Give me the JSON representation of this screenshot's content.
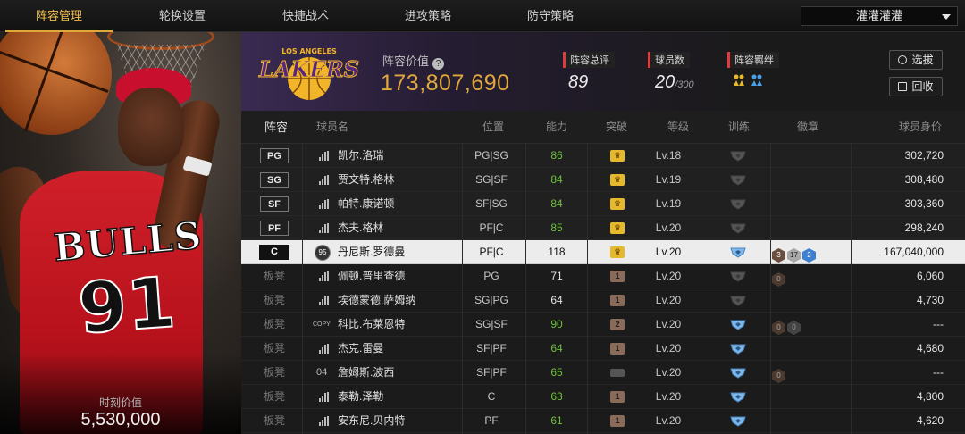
{
  "nav": {
    "tabs": [
      {
        "label": "阵容管理",
        "active": true
      },
      {
        "label": "轮换设置",
        "active": false
      },
      {
        "label": "快捷战术",
        "active": false
      },
      {
        "label": "进攻策略",
        "active": false
      },
      {
        "label": "防守策略",
        "active": false
      }
    ],
    "team_selector": "灌灌灌灌"
  },
  "player_card": {
    "jersey_name": "BULLS",
    "jersey_number": "91",
    "value_label": "时刻价值",
    "value": "5,530,000"
  },
  "header": {
    "logo_text": "LAKERS",
    "logo_city": "LOS ANGELES",
    "lineup_value_label": "阵容价值",
    "lineup_value": "173,807,690",
    "rating_label": "阵容总评",
    "rating_value": "89",
    "players_label": "球员数",
    "players_value": "20",
    "players_max": "/300",
    "bonds_label": "阵容羁绊",
    "select_button": "选拔",
    "recycle_button": "回收"
  },
  "table": {
    "columns": [
      "阵容",
      "球员名",
      "位置",
      "能力",
      "突破",
      "等级",
      "训练",
      "徽章",
      "球员身价"
    ],
    "rows": [
      {
        "slot": "PG",
        "type": "starter",
        "icon": "bars",
        "name": "凯尔.洛瑞",
        "pos": "PG|SG",
        "ovr": "86",
        "ovr_color": "green",
        "breakthrough": "crown-gold",
        "level": "Lv.18",
        "train": "gray",
        "badges": [],
        "salary": "302,720"
      },
      {
        "slot": "SG",
        "type": "starter",
        "icon": "bars",
        "name": "贾文特.格林",
        "pos": "SG|SF",
        "ovr": "84",
        "ovr_color": "green",
        "breakthrough": "crown-gold",
        "level": "Lv.19",
        "train": "gray",
        "badges": [],
        "salary": "308,480"
      },
      {
        "slot": "SF",
        "type": "starter",
        "icon": "bars",
        "name": "帕特.康诺顿",
        "pos": "SF|SG",
        "ovr": "84",
        "ovr_color": "green",
        "breakthrough": "crown-gold",
        "level": "Lv.19",
        "train": "gray",
        "badges": [],
        "salary": "303,360"
      },
      {
        "slot": "PF",
        "type": "starter",
        "icon": "bars",
        "name": "杰夫.格林",
        "pos": "PF|C",
        "ovr": "85",
        "ovr_color": "green",
        "breakthrough": "crown-gold",
        "level": "Lv.20",
        "train": "gray",
        "badges": [],
        "salary": "298,240"
      },
      {
        "slot": "C",
        "type": "selected",
        "icon": "rating",
        "icon_text": "95",
        "name": "丹尼斯.罗德曼",
        "pos": "PF|C",
        "ovr": "118",
        "ovr_color": "white",
        "breakthrough": "crown-gold",
        "level": "Lv.20",
        "train": "blue",
        "badges": [
          {
            "style": "brown",
            "text": "3"
          },
          {
            "style": "silver",
            "text": "17"
          },
          {
            "style": "blue",
            "text": "2"
          }
        ],
        "salary": "167,040,000"
      },
      {
        "slot": "板凳",
        "type": "bench",
        "icon": "bars",
        "name": "佩顿.普里查德",
        "pos": "PG",
        "ovr": "71",
        "ovr_color": "white",
        "breakthrough": "bronze-1",
        "level": "Lv.20",
        "train": "gray",
        "badges": [
          {
            "style": "dark",
            "text": "0"
          }
        ],
        "salary": "6,060"
      },
      {
        "slot": "板凳",
        "type": "bench",
        "icon": "bars",
        "name": "埃德蒙德.萨姆纳",
        "pos": "SG|PG",
        "ovr": "64",
        "ovr_color": "white",
        "breakthrough": "bronze-1",
        "level": "Lv.20",
        "train": "gray",
        "badges": [],
        "salary": "4,730"
      },
      {
        "slot": "板凳",
        "type": "bench",
        "icon": "copy",
        "icon_text": "COPY",
        "name": "科比.布莱恩特",
        "pos": "SG|SF",
        "ovr": "90",
        "ovr_color": "green",
        "breakthrough": "bronze-2",
        "level": "Lv.20",
        "train": "blue",
        "badges": [
          {
            "style": "dark",
            "text": "0"
          },
          {
            "style": "darkgray",
            "text": "0"
          }
        ],
        "salary": "---"
      },
      {
        "slot": "板凳",
        "type": "bench",
        "icon": "bars",
        "name": "杰克.雷曼",
        "pos": "SF|PF",
        "ovr": "64",
        "ovr_color": "green",
        "breakthrough": "bronze-1",
        "level": "Lv.20",
        "train": "blue",
        "badges": [],
        "salary": "4,680"
      },
      {
        "slot": "板凳",
        "type": "bench",
        "icon": "num",
        "icon_text": "04",
        "name": "詹姆斯.波西",
        "pos": "SF|PF",
        "ovr": "65",
        "ovr_color": "green",
        "breakthrough": "gray",
        "level": "Lv.20",
        "train": "blue",
        "badges": [
          {
            "style": "dark",
            "text": "0"
          }
        ],
        "salary": "---"
      },
      {
        "slot": "板凳",
        "type": "bench",
        "icon": "bars",
        "name": "泰勒.泽勒",
        "pos": "C",
        "ovr": "63",
        "ovr_color": "green",
        "breakthrough": "bronze-1",
        "level": "Lv.20",
        "train": "blue",
        "badges": [],
        "salary": "4,800"
      },
      {
        "slot": "板凳",
        "type": "bench",
        "icon": "bars",
        "name": "安东尼.贝内特",
        "pos": "PF",
        "ovr": "61",
        "ovr_color": "green",
        "breakthrough": "bronze-1",
        "level": "Lv.20",
        "train": "blue",
        "badges": [],
        "salary": "4,620"
      }
    ]
  },
  "colors": {
    "accent_gold": "#e2a83d",
    "ability_green": "#6ec23b",
    "label_red": "#e23a3a",
    "lakers_purple": "#552583"
  }
}
